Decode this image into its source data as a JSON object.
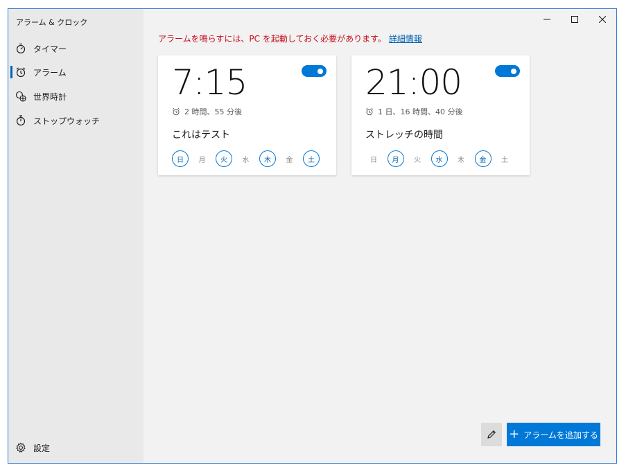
{
  "app": {
    "title": "アラーム & クロック"
  },
  "sidebar": {
    "items": [
      {
        "label": "タイマー",
        "icon": "timer-icon",
        "selected": false
      },
      {
        "label": "アラーム",
        "icon": "alarm-icon",
        "selected": true
      },
      {
        "label": "世界時計",
        "icon": "globe-icon",
        "selected": false
      },
      {
        "label": "ストップウォッチ",
        "icon": "stopwatch-icon",
        "selected": false
      }
    ],
    "settings_label": "設定"
  },
  "warning": {
    "text": "アラームを鳴らすには、PC を起動しておく必要があります。",
    "link": "詳細情報"
  },
  "day_labels": [
    "日",
    "月",
    "火",
    "水",
    "木",
    "金",
    "土"
  ],
  "alarms": [
    {
      "time": "7:15",
      "remaining": "2 時間、55 分後",
      "name": "これはテスト",
      "enabled": true,
      "days_on": [
        true,
        false,
        true,
        false,
        true,
        false,
        true
      ]
    },
    {
      "time": "21:00",
      "remaining": "1 日、16 時間、40 分後",
      "name": "ストレッチの時間",
      "enabled": true,
      "days_on": [
        false,
        true,
        false,
        true,
        false,
        true,
        false
      ]
    }
  ],
  "actions": {
    "add_label": "アラームを追加する"
  },
  "colors": {
    "accent": "#0078d7",
    "warning": "#c50f1f",
    "link": "#0063b1"
  }
}
